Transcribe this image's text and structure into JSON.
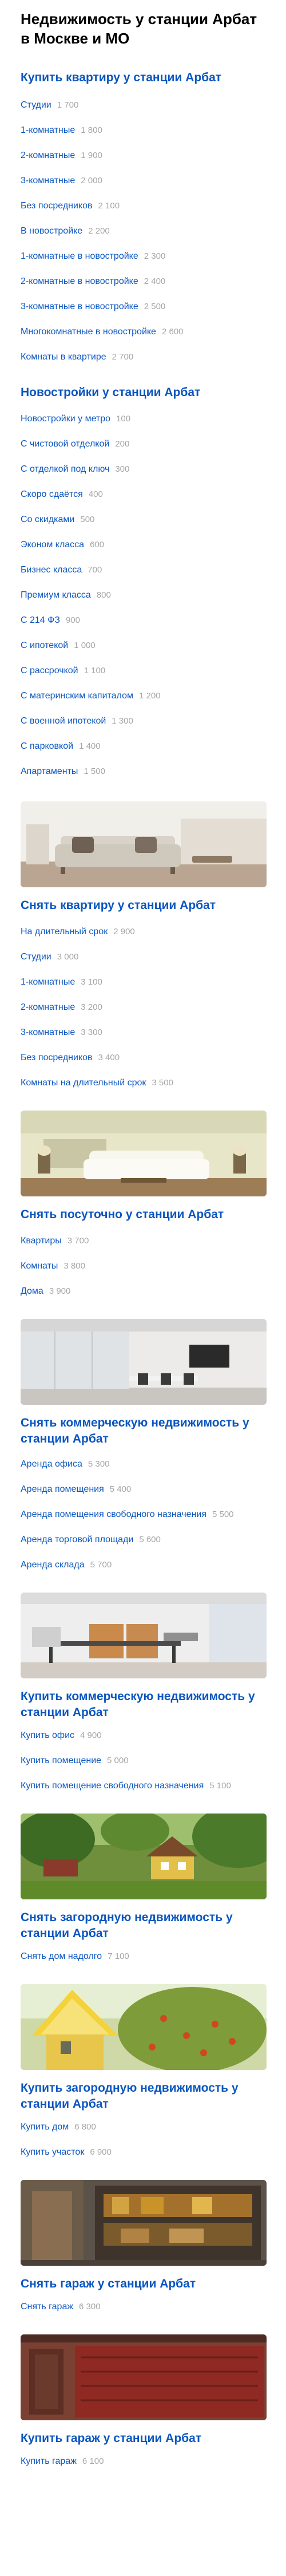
{
  "page_title": "Недвижимость у станции Арбат в Москве и МО",
  "sections": [
    {
      "title": "Купить квартиру у станции Арбат",
      "items": [
        {
          "label": "Студии",
          "count": "1 700"
        },
        {
          "label": "1-комнатные",
          "count": "1 800"
        },
        {
          "label": "2-комнатные",
          "count": "1 900"
        },
        {
          "label": "3-комнатные",
          "count": "2 000"
        },
        {
          "label": "Без посредников",
          "count": "2 100"
        },
        {
          "label": "В новостройке",
          "count": "2 200"
        },
        {
          "label": "1-комнатные в новостройке",
          "count": "2 300"
        },
        {
          "label": "2-комнатные в новостройке",
          "count": "2 400"
        },
        {
          "label": "3-комнатные в новостройке",
          "count": "2 500"
        },
        {
          "label": "Многокомнатные в новостройке",
          "count": "2 600"
        },
        {
          "label": "Комнаты в квартире",
          "count": "2 700"
        }
      ]
    },
    {
      "title": "Новостройки у станции Арбат",
      "items": [
        {
          "label": "Новостройки у метро",
          "count": "100"
        },
        {
          "label": "С чистовой отделкой",
          "count": "200"
        },
        {
          "label": "С отделкой под ключ",
          "count": "300"
        },
        {
          "label": "Скоро сдаётся",
          "count": "400"
        },
        {
          "label": "Со скидками",
          "count": "500"
        },
        {
          "label": "Эконом класса",
          "count": "600"
        },
        {
          "label": "Бизнес класса",
          "count": "700"
        },
        {
          "label": "Премиум класса",
          "count": "800"
        },
        {
          "label": "С 214 ФЗ",
          "count": "900"
        },
        {
          "label": "С ипотекой",
          "count": "1 000"
        },
        {
          "label": "С рассрочкой",
          "count": "1 100"
        },
        {
          "label": "С материнским капиталом",
          "count": "1 200"
        },
        {
          "label": "С военной ипотекой",
          "count": "1 300"
        },
        {
          "label": "С парковкой",
          "count": "1 400"
        },
        {
          "label": "Апартаменты",
          "count": "1 500"
        }
      ]
    },
    {
      "title": "Снять квартиру у станции Арбат",
      "image": "sofa-living-room-photo",
      "items": [
        {
          "label": "На длительный срок",
          "count": "2 900"
        },
        {
          "label": "Студии",
          "count": "3 000"
        },
        {
          "label": "1-комнатные",
          "count": "3 100"
        },
        {
          "label": "2-комнатные",
          "count": "3 200"
        },
        {
          "label": "3-комнатные",
          "count": "3 300"
        },
        {
          "label": "Без посредников",
          "count": "3 400"
        },
        {
          "label": "Комнаты на длительный срок",
          "count": "3 500"
        }
      ]
    },
    {
      "title": "Снять посуточно у станции Арбат",
      "image": "white-sofa-room-photo",
      "items": [
        {
          "label": "Квартиры",
          "count": "3 700"
        },
        {
          "label": "Комнаты",
          "count": "3 800"
        },
        {
          "label": "Дома",
          "count": "3 900"
        }
      ]
    },
    {
      "title": "Снять коммерческую недвижимость у станции Арбат",
      "image": "office-meeting-room-photo",
      "items": [
        {
          "label": "Аренда офиса",
          "count": "5 300"
        },
        {
          "label": "Аренда помещения",
          "count": "5 400"
        },
        {
          "label": "Аренда помещения свободного назначения",
          "count": "5 500"
        },
        {
          "label": "Аренда торговой площади",
          "count": "5 600"
        },
        {
          "label": "Аренда склада",
          "count": "5 700"
        }
      ]
    },
    {
      "title": "Купить коммерческую недвижимость у станции Арбат",
      "image": "office-desk-photo",
      "items": [
        {
          "label": "Купить офис",
          "count": "4 900"
        },
        {
          "label": "Купить помещение",
          "count": "5 000"
        },
        {
          "label": "Купить помещение свободного назначения",
          "count": "5 100"
        }
      ]
    },
    {
      "title": "Снять загородную недвижимость у станции Арбат",
      "image": "country-house-photo",
      "items": [
        {
          "label": "Снять дом надолго",
          "count": "7 100"
        }
      ]
    },
    {
      "title": "Купить загородную недвижимость у станции Арбат",
      "image": "yellow-house-rowan-photo",
      "items": [
        {
          "label": "Купить дом",
          "count": "6 800"
        },
        {
          "label": "Купить участок",
          "count": "6 900"
        }
      ]
    },
    {
      "title": "Снять гараж у станции Арбат",
      "image": "garage-interior-photo",
      "items": [
        {
          "label": "Снять гараж",
          "count": "6 300"
        }
      ]
    },
    {
      "title": "Купить гараж у станции Арбат",
      "image": "garage-door-photo",
      "items": [
        {
          "label": "Купить гараж",
          "count": "6 100"
        }
      ]
    }
  ]
}
